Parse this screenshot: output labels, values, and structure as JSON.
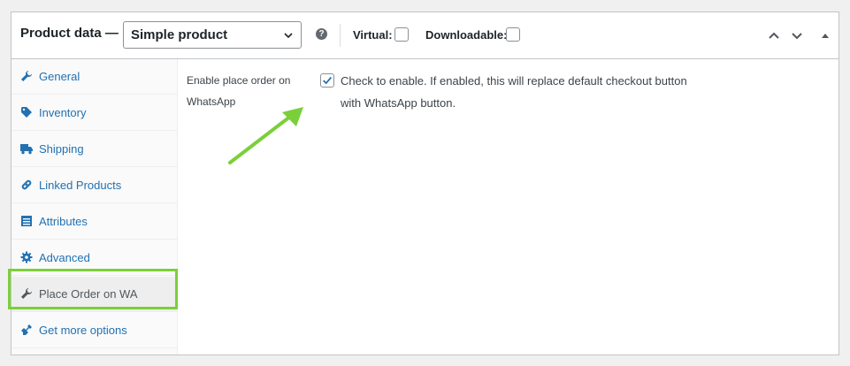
{
  "header": {
    "title": "Product data —",
    "product_type": "Simple product",
    "help": "?",
    "virtual_label": "Virtual:",
    "downloadable_label": "Downloadable:"
  },
  "sidebar": {
    "items": [
      {
        "label": "General",
        "icon": "wrench-icon"
      },
      {
        "label": "Inventory",
        "icon": "tag-icon"
      },
      {
        "label": "Shipping",
        "icon": "truck-icon"
      },
      {
        "label": "Linked Products",
        "icon": "link-icon"
      },
      {
        "label": "Attributes",
        "icon": "list-icon"
      },
      {
        "label": "Advanced",
        "icon": "gear-icon"
      },
      {
        "label": "Place Order on WA",
        "icon": "wrench-icon"
      },
      {
        "label": "Get more options",
        "icon": "plugin-icon"
      }
    ],
    "active_index": 6
  },
  "main": {
    "field_label": "Enable place order on WhatsApp",
    "checkbox_checked": true,
    "description": "Check to enable. If enabled, this will replace default checkout button with WhatsApp button."
  },
  "colors": {
    "link": "#2271b1",
    "highlight": "#7ad03a",
    "checkmark": "#2271b1"
  }
}
